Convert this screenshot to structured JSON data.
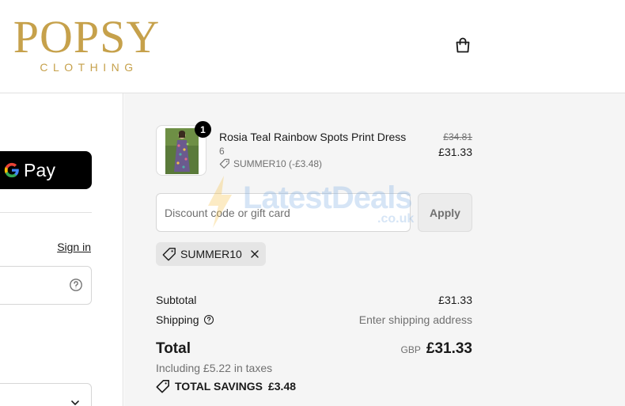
{
  "header": {
    "logo_main": "POPSY",
    "logo_sub": "CLOTHING",
    "cart_icon": "shopping-bag-icon"
  },
  "express": {
    "gpay_label": "Pay",
    "gpay_icon": "google-g-icon"
  },
  "account": {
    "sign_in": "Sign in"
  },
  "order": {
    "item": {
      "name": "Rosia Teal Rainbow Spots Print Dress",
      "variant": "6",
      "discount": "SUMMER10 (-£3.48)",
      "quantity": "1",
      "price_original": "£34.81",
      "price_final": "£31.33"
    },
    "discount_field": {
      "placeholder": "Discount code or gift card",
      "apply_label": "Apply"
    },
    "applied_code": "SUMMER10",
    "summary": {
      "subtotal_label": "Subtotal",
      "subtotal_value": "£31.33",
      "shipping_label": "Shipping",
      "shipping_value": "Enter shipping address",
      "total_label": "Total",
      "currency": "GBP",
      "total_value": "£31.33",
      "taxes": "Including £5.22 in taxes",
      "savings_label": "TOTAL SAVINGS",
      "savings_value": "£3.48"
    }
  },
  "watermark": {
    "text": "LatestDeals",
    "sub": ".co.uk"
  },
  "colors": {
    "brand_gold": "#c6a14b",
    "summary_bg": "#f5f5f5",
    "muted_text": "#707070"
  }
}
